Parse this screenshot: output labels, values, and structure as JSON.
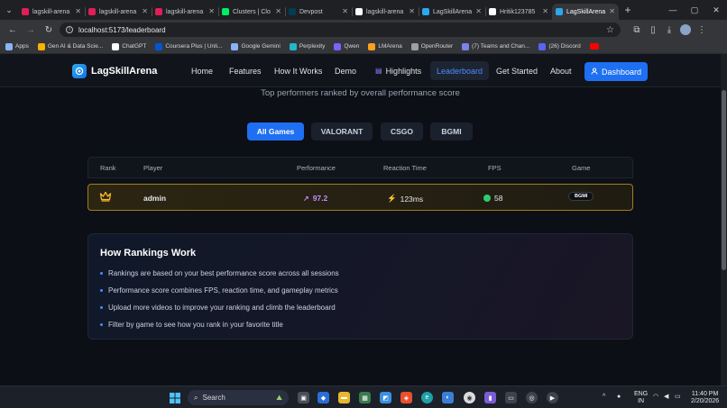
{
  "browser": {
    "tabs": [
      {
        "label": "lagskill-arena",
        "icon": "slack-icon",
        "color": "#e01e5a"
      },
      {
        "label": "lagskill-arena",
        "icon": "slack-icon",
        "color": "#e01e5a"
      },
      {
        "label": "lagskill-arena",
        "icon": "slack-icon",
        "color": "#e01e5a"
      },
      {
        "label": "Clusters | Clo",
        "icon": "mongodb-icon",
        "color": "#00ed64"
      },
      {
        "label": "Devpost",
        "icon": "devpost-icon",
        "color": "#003e54"
      },
      {
        "label": "lagskill-arena",
        "icon": "vercel-icon",
        "color": "#ffffff"
      },
      {
        "label": "LagSkillArena",
        "icon": "app-icon",
        "color": "#2aa8f0"
      },
      {
        "label": "Hritik123785",
        "icon": "github-icon",
        "color": "#ffffff"
      },
      {
        "label": "LagSkillArena",
        "icon": "app-icon",
        "color": "#2aa8f0"
      }
    ],
    "url": "localhost:5173/leaderboard",
    "bookmarks": [
      {
        "label": "Apps",
        "color": "#8ab4f8"
      },
      {
        "label": "Gen AI & Data Scie...",
        "color": "#f4b400"
      },
      {
        "label": "ChatGPT",
        "color": "#ffffff"
      },
      {
        "label": "Coursera Plus | Unli...",
        "color": "#0056d2"
      },
      {
        "label": "Google Gemini",
        "color": "#8ab4f8"
      },
      {
        "label": "Perplexity",
        "color": "#20b8cd"
      },
      {
        "label": "Qwen",
        "color": "#7b61ff"
      },
      {
        "label": "LMArena",
        "color": "#ff9f1c"
      },
      {
        "label": "OpenRouter",
        "color": "#9aa0a6"
      },
      {
        "label": "(7) Teams and Chan...",
        "color": "#7b83eb"
      },
      {
        "label": "(26) Discord",
        "color": "#5865f2"
      }
    ]
  },
  "site": {
    "logo": "LagSkillArena",
    "nav": [
      "Home",
      "Features",
      "How It Works",
      "Demo",
      "Highlights",
      "Leaderboard",
      "Get Started",
      "About"
    ],
    "dashboard": "Dashboard",
    "subtitle": "Top performers ranked by overall performance score",
    "filters": [
      "All Games",
      "VALORANT",
      "CSGO",
      "BGMI"
    ],
    "columns": [
      "Rank",
      "Player",
      "Performance",
      "Reaction Time",
      "FPS",
      "Game"
    ],
    "row": {
      "player": "admin",
      "performance": "97.2",
      "reaction": "123ms",
      "fps": "58",
      "game": "BGMI"
    },
    "how": {
      "title": "How Rankings Work",
      "items": [
        "Rankings are based on your best performance score across all sessions",
        "Performance score combines FPS, reaction time, and gameplay metrics",
        "Upload more videos to improve your ranking and climb the leaderboard",
        "Filter by game to see how you rank in your favorite title"
      ]
    }
  },
  "taskbar": {
    "search": "Search",
    "lang": "ENG",
    "region": "IN",
    "time": "11:40 PM",
    "date": "2/20/2026"
  }
}
